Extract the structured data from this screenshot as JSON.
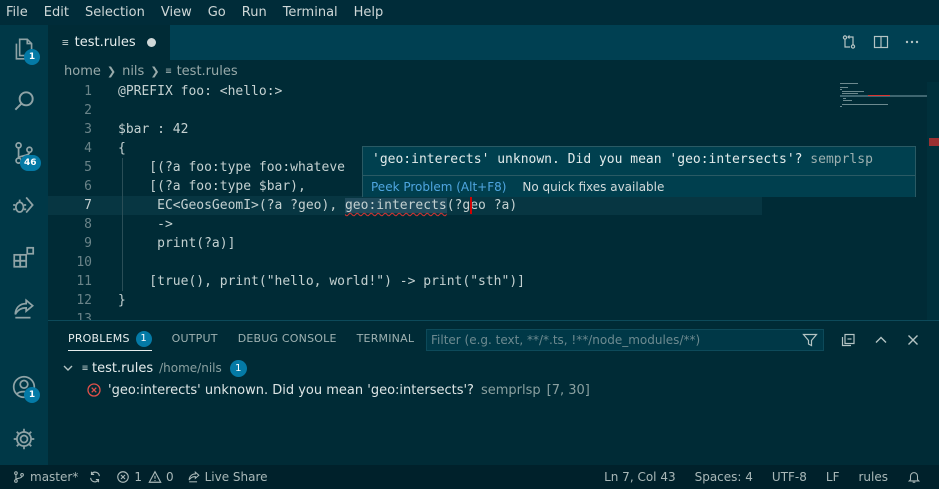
{
  "menubar": {
    "items": [
      "File",
      "Edit",
      "Selection",
      "View",
      "Go",
      "Run",
      "Terminal",
      "Help"
    ]
  },
  "activitybar": {
    "items": [
      {
        "name": "explorer",
        "icon": "files-icon",
        "badge": "1"
      },
      {
        "name": "search",
        "icon": "search-icon",
        "badge": ""
      },
      {
        "name": "source-control",
        "icon": "source-control-icon",
        "badge": "46"
      },
      {
        "name": "run-debug",
        "icon": "debug-icon",
        "badge": ""
      },
      {
        "name": "extensions",
        "icon": "extensions-icon",
        "badge": ""
      },
      {
        "name": "live-share",
        "icon": "live-share-icon",
        "badge": ""
      },
      {
        "name": "accounts",
        "icon": "account-icon",
        "badge": "1"
      },
      {
        "name": "manage",
        "icon": "gear-icon",
        "badge": ""
      }
    ]
  },
  "tab": {
    "glyph": "≡",
    "name": "test.rules",
    "dirty": true
  },
  "breadcrumb": {
    "parts": [
      "home",
      "nils",
      "test.rules"
    ],
    "file_glyph": "≡"
  },
  "editor": {
    "active_line": 7,
    "lines": [
      {
        "n": "1",
        "text": "@PREFIX foo: <hello:>"
      },
      {
        "n": "2",
        "text": ""
      },
      {
        "n": "3",
        "text": "$bar : 42"
      },
      {
        "n": "4",
        "text": "{"
      },
      {
        "n": "5",
        "text": "    [(?a foo:type foo:whateve"
      },
      {
        "n": "6",
        "text": "    [(?a foo:type $bar),"
      },
      {
        "n": "7",
        "pre": "     EC<GeosGeomI>(?a ?geo), ",
        "err": "geo:interects",
        "post": "(?geo ?a)"
      },
      {
        "n": "8",
        "text": "     ->"
      },
      {
        "n": "9",
        "text": "     print(?a)]"
      },
      {
        "n": "10",
        "text": ""
      },
      {
        "n": "11",
        "text": "    [true(), print(\"hello, world!\") -> print(\"sth\")]"
      },
      {
        "n": "12",
        "text": "}"
      },
      {
        "n": "13",
        "text": ""
      }
    ]
  },
  "hover": {
    "message": "'geo:interects' unknown. Did you mean 'geo:intersects'?",
    "source": "semprlsp",
    "peek_label": "Peek Problem (Alt+F8)",
    "no_fixes": "No quick fixes available"
  },
  "panel": {
    "tabs": [
      {
        "label": "PROBLEMS",
        "badge": "1",
        "active": true
      },
      {
        "label": "OUTPUT",
        "badge": "",
        "active": false
      },
      {
        "label": "DEBUG CONSOLE",
        "badge": "",
        "active": false
      },
      {
        "label": "TERMINAL",
        "badge": "",
        "active": false
      }
    ],
    "filter_placeholder": "Filter (e.g. text, **/*.ts, !**/node_modules/**)",
    "file": {
      "name": "test.rules",
      "path": "/home/nils",
      "count": "1"
    },
    "problem": {
      "message": "'geo:interects' unknown. Did you mean 'geo:intersects'?",
      "source": "semprlsp",
      "location": "[7, 30]"
    }
  },
  "statusbar": {
    "branch": "master*",
    "errors": "1",
    "warnings": "0",
    "live_share": "Live Share",
    "position": "Ln 7, Col 43",
    "spaces": "Spaces: 4",
    "encoding": "UTF-8",
    "eol": "LF",
    "language": "rules"
  },
  "colors": {
    "background": "#002b36",
    "accent_badge": "#047aa6",
    "error": "#dc322f",
    "link": "#4fa6e0"
  }
}
